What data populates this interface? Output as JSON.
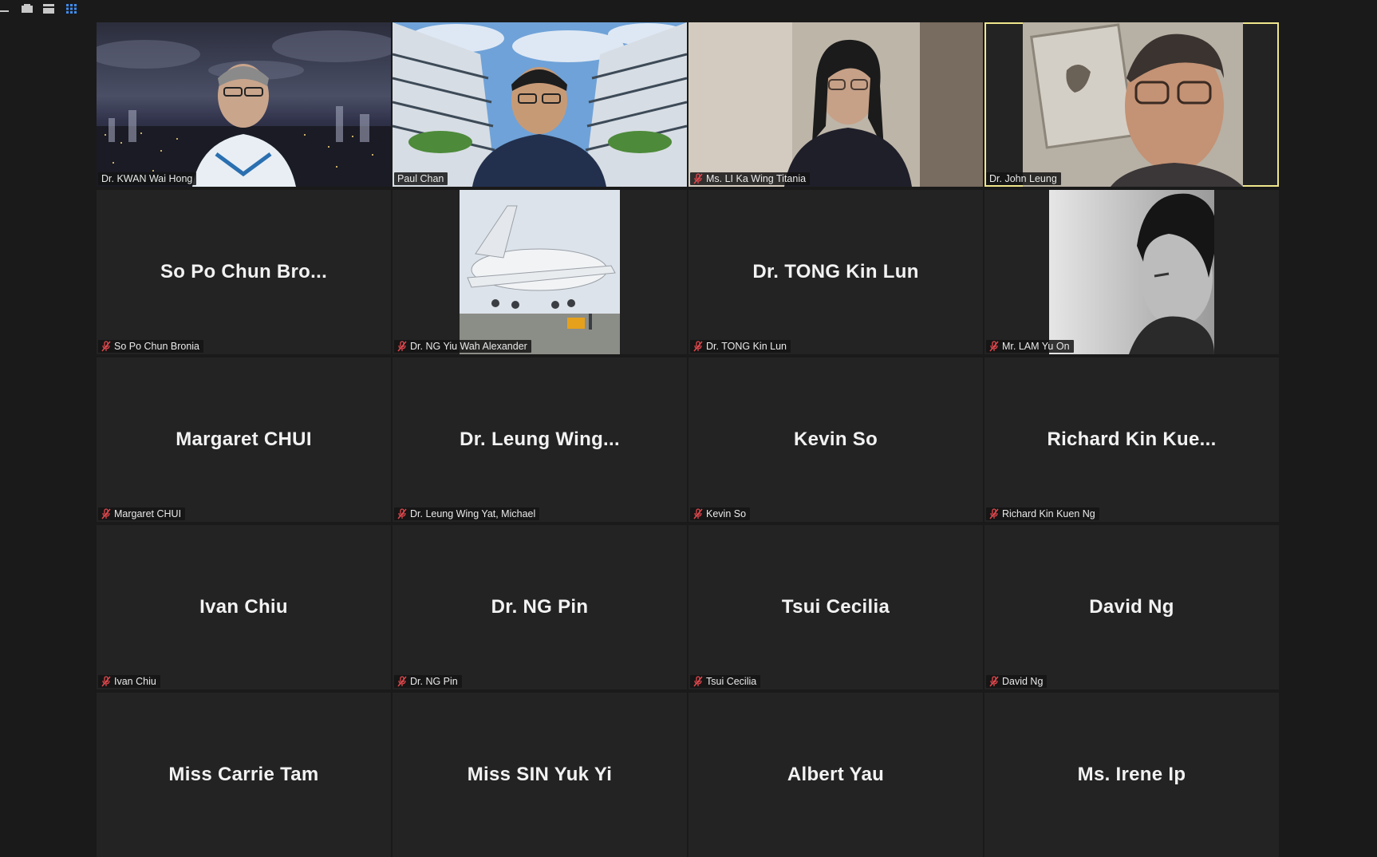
{
  "toolbar": {
    "views": [
      {
        "name": "minimize-icon",
        "color": "#c8c8c8"
      },
      {
        "name": "speaker-view-icon",
        "color": "#c8c8c8"
      },
      {
        "name": "strip-view-icon",
        "color": "#c8c8c8"
      },
      {
        "name": "gallery-view-icon",
        "color": "#3d8ef0"
      }
    ]
  },
  "tiles": [
    {
      "label": "Dr. KWAN Wai Hong",
      "muted": false,
      "video": "cityscape-night"
    },
    {
      "label": "Paul Chan",
      "muted": false,
      "video": "building-courtyard"
    },
    {
      "label": "Ms. LI Ka Wing Titania",
      "muted": true,
      "video": "home-office"
    },
    {
      "label": "Dr. John Leung",
      "muted": false,
      "video": "wall-art",
      "active": true
    },
    {
      "label": "So Po Chun Bronia",
      "display": "So Po Chun Bro...",
      "muted": true
    },
    {
      "label": "Dr. NG Yiu Wah Alexander",
      "muted": true,
      "video": "airplane-photo"
    },
    {
      "label": "Dr. TONG Kin Lun",
      "display": "Dr. TONG Kin Lun",
      "muted": true
    },
    {
      "label": "Mr. LAM Yu On",
      "muted": true,
      "video": "bw-portrait"
    },
    {
      "label": "Margaret CHUI",
      "display": "Margaret CHUI",
      "muted": true
    },
    {
      "label": "Dr. Leung Wing Yat, Michael",
      "display": "Dr. Leung Wing...",
      "muted": true
    },
    {
      "label": "Kevin So",
      "display": "Kevin So",
      "muted": true
    },
    {
      "label": "Richard Kin Kuen Ng",
      "display": "Richard Kin Kue...",
      "muted": true
    },
    {
      "label": "Ivan Chiu",
      "display": "Ivan Chiu",
      "muted": true
    },
    {
      "label": "Dr. NG Pin",
      "display": "Dr. NG Pin",
      "muted": true
    },
    {
      "label": "Tsui Cecilia",
      "display": "Tsui Cecilia",
      "muted": true
    },
    {
      "label": "David Ng",
      "display": "David Ng",
      "muted": true
    },
    {
      "display": "Miss Carrie Tam"
    },
    {
      "display": "Miss SIN Yuk Yi"
    },
    {
      "display": "Albert Yau"
    },
    {
      "display": "Ms. Irene Ip"
    }
  ],
  "colors": {
    "mute_icon": "#e5484d",
    "active_border": "#f0e68c"
  }
}
